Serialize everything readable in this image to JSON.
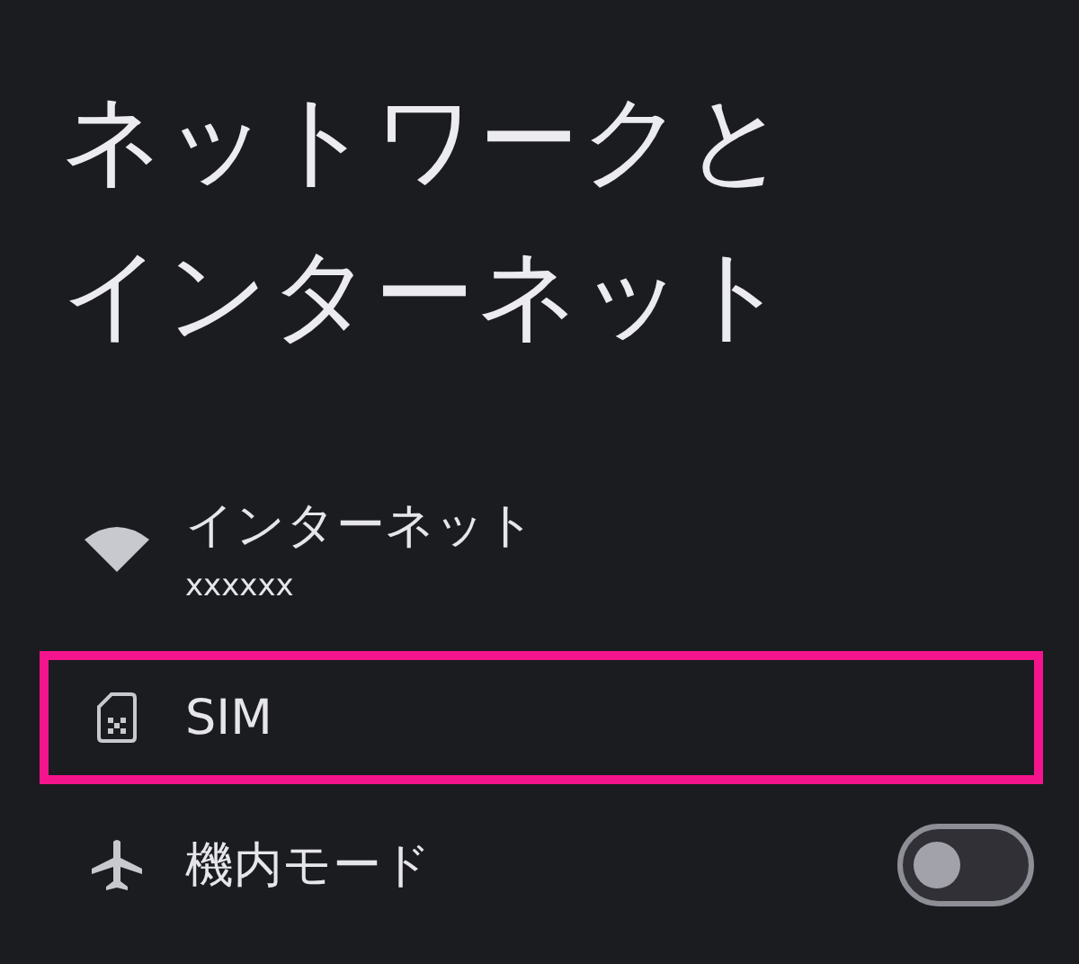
{
  "title": [
    "ネットワークと",
    "インターネット"
  ],
  "items": [
    {
      "kind": "wifi",
      "label": "インターネット",
      "subtitle": "xxxxxx",
      "highlighted": false
    },
    {
      "kind": "sim",
      "label": "SIM",
      "highlighted": true
    },
    {
      "kind": "airplane",
      "label": "機内モード",
      "highlighted": false,
      "toggle": {
        "on": false
      }
    }
  ]
}
